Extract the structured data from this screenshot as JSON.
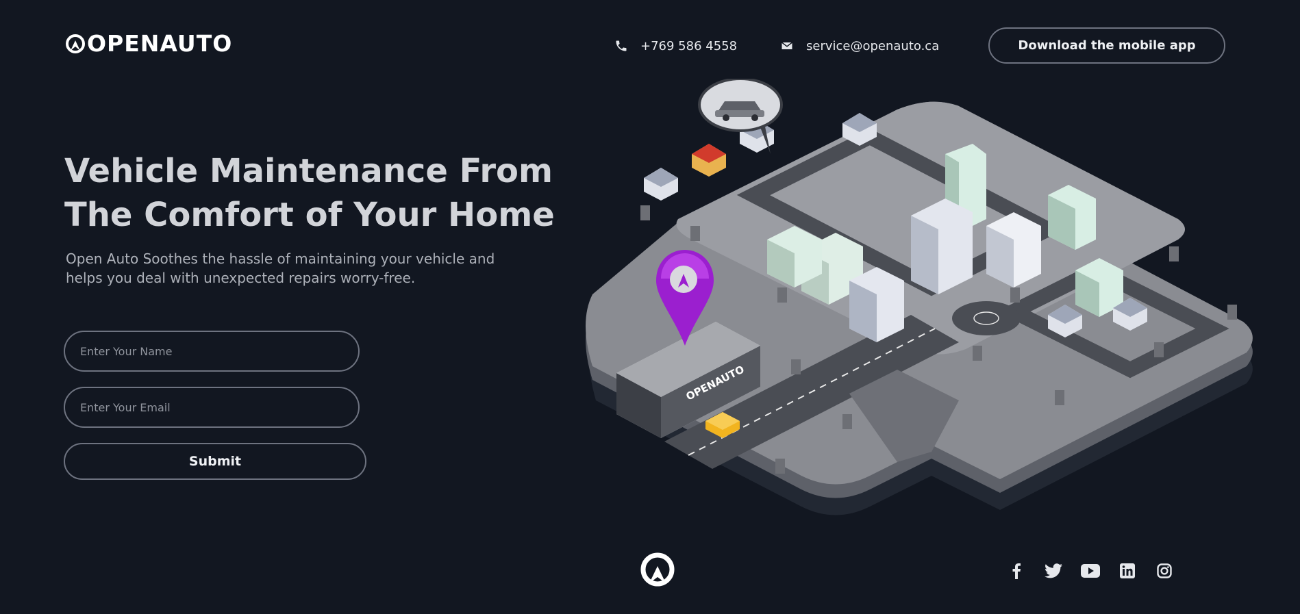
{
  "header": {
    "brand": "OPENAUTO",
    "phone": "+769 586 4558",
    "email": "service@openauto.ca",
    "cta_label": "Download the mobile app"
  },
  "hero": {
    "title_line1": "Vehicle Maintenance From",
    "title_line2": "The Comfort of Your Home",
    "subtitle_line1": "Open Auto Soothes the hassle of maintaining your vehicle and",
    "subtitle_line2": "helps you deal with unexpected repairs worry-free."
  },
  "form": {
    "name_placeholder": "Enter Your Name",
    "email_placeholder": "Enter Your Email",
    "submit_label": "Submit"
  },
  "illustration": {
    "building_sign": "OPENAUTO"
  },
  "footer": {
    "socials": [
      "facebook-icon",
      "twitter-icon",
      "youtube-icon",
      "linkedin-icon",
      "instagram-icon"
    ]
  },
  "colors": {
    "background": "#121721",
    "accent_pin": "#9b1fcf",
    "border": "#6e7380",
    "text": "#d2d4d9"
  }
}
